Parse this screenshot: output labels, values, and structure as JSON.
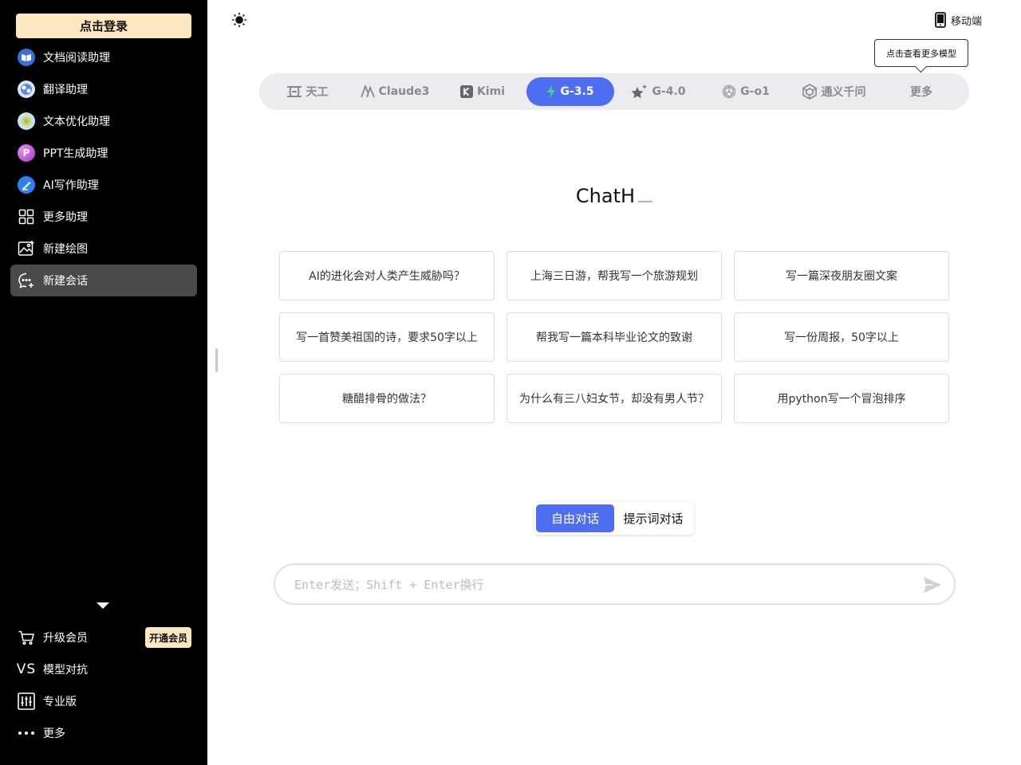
{
  "sidebar": {
    "login_label": "点击登录",
    "items": [
      {
        "label": "文档阅读助理",
        "icon": "book-icon"
      },
      {
        "label": "翻译助理",
        "icon": "translate-icon"
      },
      {
        "label": "文本优化助理",
        "icon": "text-optimize-icon"
      },
      {
        "label": "PPT生成助理",
        "icon": "ppt-icon"
      },
      {
        "label": "AI写作助理",
        "icon": "pen-icon"
      },
      {
        "label": "更多助理",
        "icon": "grid-icon"
      },
      {
        "label": "新建绘图",
        "icon": "image-icon"
      },
      {
        "label": "新建会话",
        "icon": "chat-plus-icon"
      }
    ],
    "bottom_items": [
      {
        "label": "升级会员",
        "icon": "cart-icon"
      },
      {
        "label": "模型对抗",
        "icon": "vs-icon"
      },
      {
        "label": "专业版",
        "icon": "sliders-icon"
      },
      {
        "label": "更多",
        "icon": "more-icon"
      }
    ],
    "vs_text": "VS",
    "ppt_letter": "P",
    "vip_badge": "开通会员"
  },
  "header": {
    "mobile_label": "移动端",
    "tooltip": "点击查看更多模型"
  },
  "models": [
    {
      "label": "天工",
      "icon": "tiangong-icon"
    },
    {
      "label": "Claude3",
      "icon": "claude-icon"
    },
    {
      "label": "Kimi",
      "icon": "kimi-icon"
    },
    {
      "label": "G-3.5",
      "icon": "bolt-icon",
      "selected": true
    },
    {
      "label": "G-4.0",
      "icon": "star-icon"
    },
    {
      "label": "G-o1",
      "icon": "openai-icon"
    },
    {
      "label": "通义千问",
      "icon": "tongyi-icon"
    },
    {
      "label": "更多",
      "icon": ""
    }
  ],
  "main": {
    "title": "ChatH",
    "prompts": [
      "AI的进化会对人类产生威胁吗？",
      "上海三日游，帮我写一个旅游规划",
      "写一篇深夜朋友圈文案",
      "写一首赞美祖国的诗，要求50字以上",
      "帮我写一篇本科毕业论文的致谢",
      "写一份周报，50字以上",
      "糖醋排骨的做法？",
      "为什么有三八妇女节，却没有男人节？",
      "用python写一个冒泡排序"
    ],
    "modes": [
      "自由对话",
      "提示词对话"
    ],
    "input_placeholder": "Enter发送；Shift + Enter换行",
    "input_value": ""
  },
  "colors": {
    "accent": "#4e6ef2",
    "login_bg": "#fde7c0",
    "sidebar_bg": "#000000",
    "active_item_bg": "#4a4a4a"
  }
}
